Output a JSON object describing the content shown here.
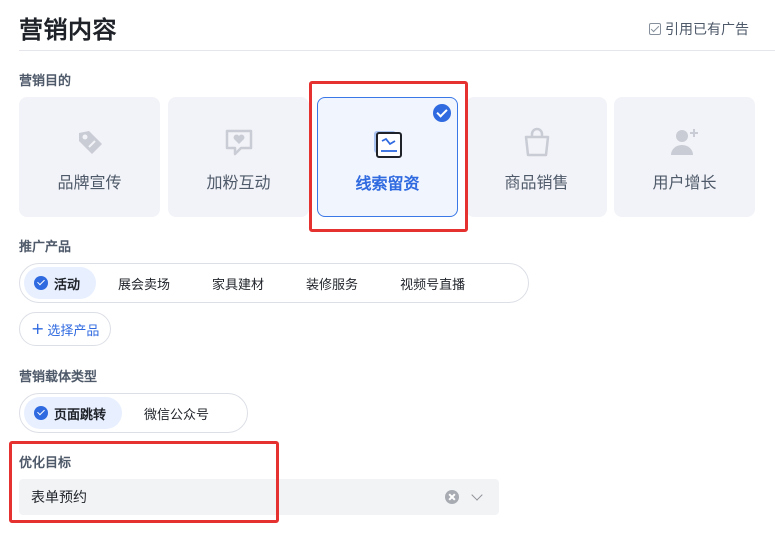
{
  "header": {
    "title": "营销内容",
    "ref_ad_label": "引用已有广告"
  },
  "marketing_goal": {
    "label": "营销目的",
    "cards": [
      {
        "label": "品牌宣传",
        "icon": "tag-icon",
        "selected": false
      },
      {
        "label": "加粉互动",
        "icon": "heart-chat-icon",
        "selected": false
      },
      {
        "label": "线索留资",
        "icon": "lead-form-icon",
        "selected": true
      },
      {
        "label": "商品销售",
        "icon": "shopping-bag-icon",
        "selected": false
      },
      {
        "label": "用户增长",
        "icon": "user-add-icon",
        "selected": false
      }
    ]
  },
  "promote_product": {
    "label": "推广产品",
    "options": [
      "活动",
      "展会卖场",
      "家具建材",
      "装修服务",
      "视频号直播"
    ],
    "selected": "活动",
    "select_button": "选择产品"
  },
  "carrier_type": {
    "label": "营销载体类型",
    "options": [
      "页面跳转",
      "微信公众号"
    ],
    "selected": "页面跳转"
  },
  "optimization_goal": {
    "label": "优化目标",
    "value": "表单预约"
  },
  "colors": {
    "accent": "#2f6ae0",
    "highlight": "#e5312f",
    "card_bg": "#f2f3f8"
  }
}
